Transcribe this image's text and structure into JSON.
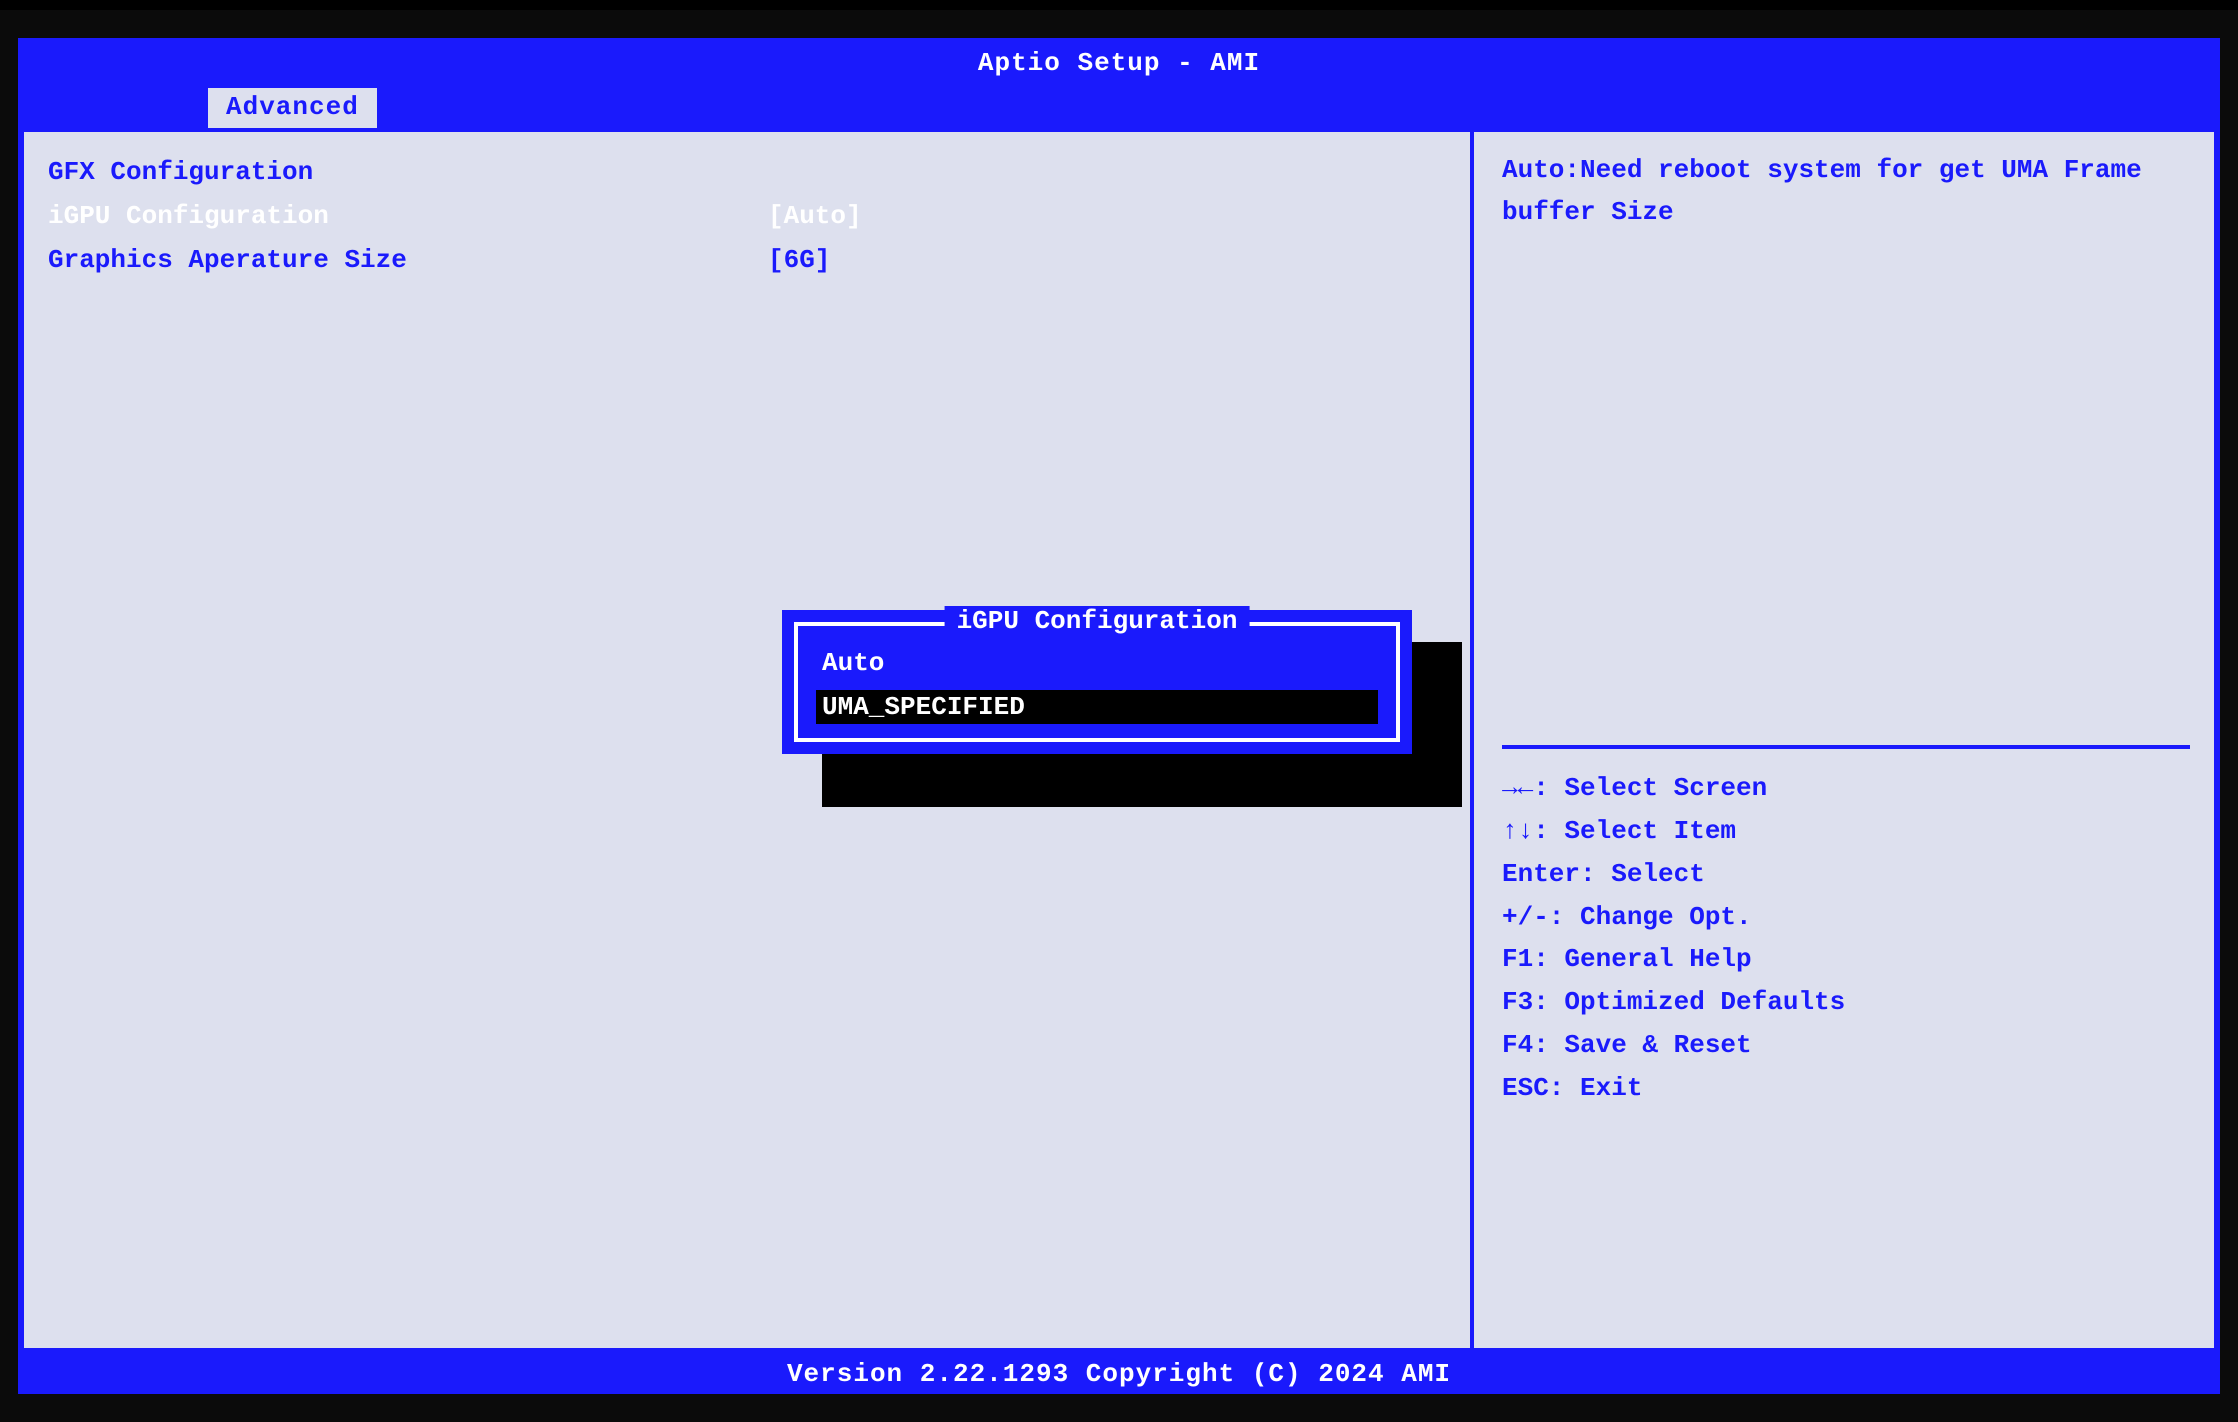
{
  "header": {
    "title": "Aptio Setup - AMI"
  },
  "tabs": {
    "active": "Advanced"
  },
  "settings": {
    "heading": "GFX Configuration",
    "items": [
      {
        "label": "iGPU Configuration",
        "value": "[Auto]",
        "selected": true
      },
      {
        "label": "Graphics Aperature Size",
        "value": "[6G]",
        "selected": false
      }
    ]
  },
  "help": {
    "text": "Auto:Need reboot system for get UMA Frame buffer Size"
  },
  "keys": [
    "→←: Select Screen",
    "↑↓: Select Item",
    "Enter: Select",
    "+/-: Change Opt.",
    "F1: General Help",
    "F3: Optimized Defaults",
    "F4: Save & Reset",
    "ESC: Exit"
  ],
  "popup": {
    "title": "iGPU Configuration",
    "options": [
      {
        "label": "Auto",
        "selected": false
      },
      {
        "label": "UMA_SPECIFIED",
        "selected": true
      }
    ]
  },
  "footer": {
    "text": "Version 2.22.1293 Copyright (C) 2024 AMI"
  }
}
